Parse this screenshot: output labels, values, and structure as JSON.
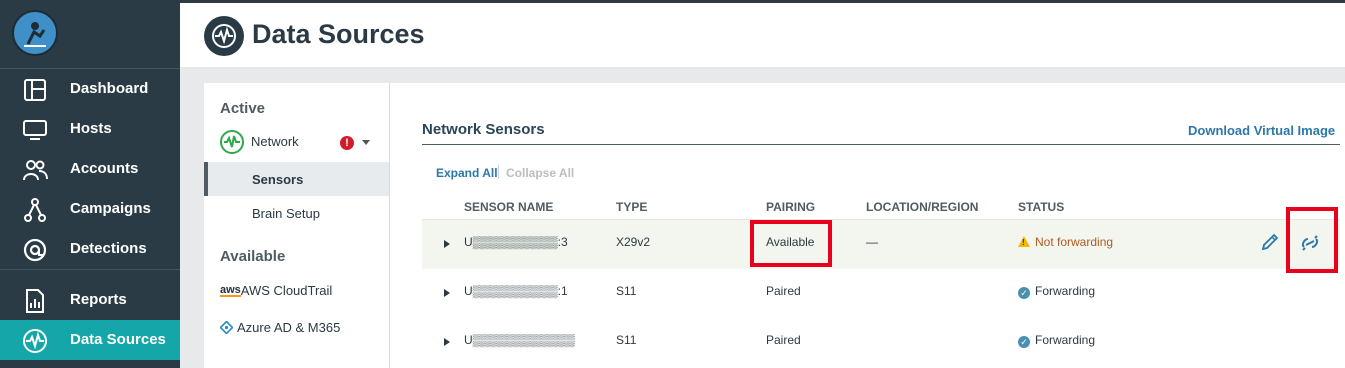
{
  "sidebar": {
    "items": [
      {
        "label": "Dashboard",
        "icon": "dashboard-icon"
      },
      {
        "label": "Hosts",
        "icon": "monitor-icon"
      },
      {
        "label": "Accounts",
        "icon": "users-icon"
      },
      {
        "label": "Campaigns",
        "icon": "campaigns-icon"
      },
      {
        "label": "Detections",
        "icon": "detections-icon"
      },
      {
        "label": "Reports",
        "icon": "reports-icon"
      },
      {
        "label": "Data Sources",
        "icon": "pulse-icon",
        "active": true
      }
    ]
  },
  "header": {
    "title": "Data Sources",
    "icon": "pulse-icon"
  },
  "subnav": {
    "active_title": "Active",
    "network": {
      "label": "Network",
      "alert": "!"
    },
    "items": [
      {
        "label": "Sensors",
        "selected": true
      },
      {
        "label": "Brain Setup"
      }
    ],
    "available_title": "Available",
    "available": [
      {
        "label": "AWS CloudTrail",
        "prefix": "aws"
      },
      {
        "label": "Azure AD & M365"
      }
    ]
  },
  "main": {
    "title": "Network Sensors",
    "download_link": "Download Virtual Image",
    "expand_all": "Expand All",
    "collapse_all": "Collapse All",
    "columns": [
      "SENSOR NAME",
      "TYPE",
      "PAIRING",
      "LOCATION/REGION",
      "STATUS"
    ],
    "rows": [
      {
        "name": "U▒▒▒▒▒▒▒▒▒▒:3",
        "type": "X29v2",
        "pairing": "Available",
        "location": "—",
        "status": "Not forwarding",
        "status_kind": "warning"
      },
      {
        "name": "U▒▒▒▒▒▒▒▒▒▒:1",
        "type": "S11",
        "pairing": "Paired",
        "location": "",
        "status": "Forwarding",
        "status_kind": "ok"
      },
      {
        "name": "U▒▒▒▒▒▒▒▒▒▒▒▒",
        "type": "S11",
        "pairing": "Paired",
        "location": "",
        "status": "Forwarding",
        "status_kind": "ok"
      }
    ]
  },
  "colors": {
    "sidebar_bg": "#2a3b45",
    "active_teal": "#14a6a8",
    "link_blue": "#2c78a8",
    "highlight_red": "#e8001c"
  }
}
